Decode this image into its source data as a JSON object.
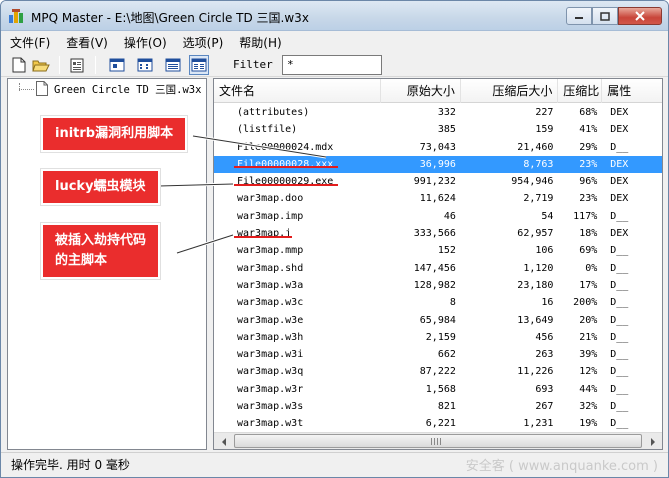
{
  "window": {
    "title": "MPQ Master - E:\\地图\\Green Circle TD 三国.w3x"
  },
  "menu": [
    "文件(F)",
    "查看(V)",
    "操作(O)",
    "选项(P)",
    "帮助(H)"
  ],
  "toolbar": {
    "filter_label": "Filter",
    "filter_value": "*",
    "icons": [
      "new-file-icon",
      "open-folder-icon",
      "properties-icon",
      "large-icons-view-icon",
      "small-icons-view-icon",
      "list-view-icon",
      "details-view-icon"
    ]
  },
  "tree": {
    "root_label": "Green Circle TD 三国.w3x"
  },
  "list": {
    "columns": [
      "文件名",
      "原始大小",
      "压缩后大小",
      "压缩比",
      "属性"
    ],
    "rows": [
      {
        "name": "(attributes)",
        "orig": "332",
        "comp": "227",
        "ratio": "68%",
        "attr": "DEX"
      },
      {
        "name": "(listfile)",
        "orig": "385",
        "comp": "159",
        "ratio": "41%",
        "attr": "DEX"
      },
      {
        "name": "File00000024.mdx",
        "orig": "73,043",
        "comp": "21,460",
        "ratio": "29%",
        "attr": "D__"
      },
      {
        "name": "File00000028.xxx",
        "orig": "36,996",
        "comp": "8,763",
        "ratio": "23%",
        "attr": "DEX",
        "selected": true
      },
      {
        "name": "File00000029.exe",
        "orig": "991,232",
        "comp": "954,946",
        "ratio": "96%",
        "attr": "DEX"
      },
      {
        "name": "war3map.doo",
        "orig": "11,624",
        "comp": "2,719",
        "ratio": "23%",
        "attr": "DEX"
      },
      {
        "name": "war3map.imp",
        "orig": "46",
        "comp": "54",
        "ratio": "117%",
        "attr": "D__"
      },
      {
        "name": "war3map.j",
        "orig": "333,566",
        "comp": "62,957",
        "ratio": "18%",
        "attr": "DEX"
      },
      {
        "name": "war3map.mmp",
        "orig": "152",
        "comp": "106",
        "ratio": "69%",
        "attr": "D__"
      },
      {
        "name": "war3map.shd",
        "orig": "147,456",
        "comp": "1,120",
        "ratio": "0%",
        "attr": "D__"
      },
      {
        "name": "war3map.w3a",
        "orig": "128,982",
        "comp": "23,180",
        "ratio": "17%",
        "attr": "D__"
      },
      {
        "name": "war3map.w3c",
        "orig": "8",
        "comp": "16",
        "ratio": "200%",
        "attr": "D__"
      },
      {
        "name": "war3map.w3e",
        "orig": "65,984",
        "comp": "13,649",
        "ratio": "20%",
        "attr": "D__"
      },
      {
        "name": "war3map.w3h",
        "orig": "2,159",
        "comp": "456",
        "ratio": "21%",
        "attr": "D__"
      },
      {
        "name": "war3map.w3i",
        "orig": "662",
        "comp": "263",
        "ratio": "39%",
        "attr": "D__"
      },
      {
        "name": "war3map.w3q",
        "orig": "87,222",
        "comp": "11,226",
        "ratio": "12%",
        "attr": "D__"
      },
      {
        "name": "war3map.w3r",
        "orig": "1,568",
        "comp": "693",
        "ratio": "44%",
        "attr": "D__"
      },
      {
        "name": "war3map.w3s",
        "orig": "821",
        "comp": "267",
        "ratio": "32%",
        "attr": "D__"
      },
      {
        "name": "war3map.w3t",
        "orig": "6,221",
        "comp": "1,231",
        "ratio": "19%",
        "attr": "D__"
      }
    ]
  },
  "annotations": {
    "a1": "initrb漏洞利用脚本",
    "a2": "lucky蠕虫模块",
    "a3_line1": "被插入劫持代码",
    "a3_line2": "的主脚本"
  },
  "status": {
    "text": "操作完毕. 用时 0 毫秒",
    "watermark": "安全客 ( www.anquanke.com )"
  },
  "colors": {
    "selection": "#3399ff",
    "annotation": "#ea2d2d"
  }
}
